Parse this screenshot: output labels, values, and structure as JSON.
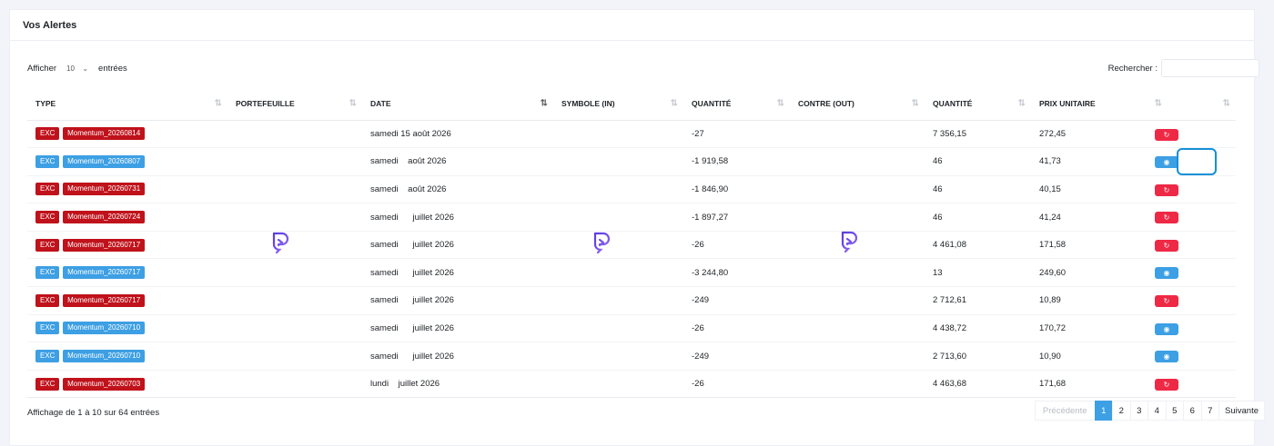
{
  "card": {
    "title": "Vos Alertes"
  },
  "length_control": {
    "prefix": "Afficher",
    "value": "10",
    "suffix": "entrées"
  },
  "search": {
    "label": "Rechercher :",
    "value": ""
  },
  "columns": [
    {
      "label": "TYPE",
      "sort": "⇅"
    },
    {
      "label": "PORTEFEUILLE",
      "sort": "⇅"
    },
    {
      "label": "DATE",
      "sort": "⇅"
    },
    {
      "label": "SYMBOLE (IN)",
      "sort": "⇅"
    },
    {
      "label": "QUANTITÉ",
      "sort": "⇅"
    },
    {
      "label": "CONTRE (OUT)",
      "sort": "⇅"
    },
    {
      "label": "QUANTITÉ",
      "sort": "⇅"
    },
    {
      "label": "PRIX UNITAIRE",
      "sort": "⇅"
    },
    {
      "label": "",
      "sort": "⇅"
    }
  ],
  "rows": [
    {
      "type": "EXC",
      "name": "Momentum_20260814",
      "color": "red",
      "date": "samedi 15 août 2026",
      "qty_in": "-27",
      "qty_out": "7 356,15",
      "price": "272,45",
      "action": "undo"
    },
    {
      "type": "EXC",
      "name": "Momentum_20260807",
      "color": "blue",
      "date": "samedi    août 2026",
      "qty_in": "-1 919,58",
      "qty_out": "46",
      "price": "41,73",
      "action": "view"
    },
    {
      "type": "EXC",
      "name": "Momentum_20260731",
      "color": "red",
      "date": "samedi    août 2026",
      "qty_in": "-1 846,90",
      "qty_out": "46",
      "price": "40,15",
      "action": "undo"
    },
    {
      "type": "EXC",
      "name": "Momentum_20260724",
      "color": "red",
      "date": "samedi      juillet 2026",
      "qty_in": "-1 897,27",
      "qty_out": "46",
      "price": "41,24",
      "action": "undo"
    },
    {
      "type": "EXC",
      "name": "Momentum_20260717",
      "color": "red",
      "date": "samedi      juillet 2026",
      "qty_in": "-26",
      "qty_out": "4 461,08",
      "price": "171,58",
      "action": "undo"
    },
    {
      "type": "EXC",
      "name": "Momentum_20260717",
      "color": "blue",
      "date": "samedi      juillet 2026",
      "qty_in": "-3 244,80",
      "qty_out": "13",
      "price": "249,60",
      "action": "view"
    },
    {
      "type": "EXC",
      "name": "Momentum_20260717",
      "color": "red",
      "date": "samedi      juillet 2026",
      "qty_in": "-249",
      "qty_out": "2 712,61",
      "price": "10,89",
      "action": "undo"
    },
    {
      "type": "EXC",
      "name": "Momentum_20260710",
      "color": "blue",
      "date": "samedi      juillet 2026",
      "qty_in": "-26",
      "qty_out": "4 438,72",
      "price": "170,72",
      "action": "view"
    },
    {
      "type": "EXC",
      "name": "Momentum_20260710",
      "color": "blue",
      "date": "samedi      juillet 2026",
      "qty_in": "-249",
      "qty_out": "2 713,60",
      "price": "10,90",
      "action": "view"
    },
    {
      "type": "EXC",
      "name": "Momentum_20260703",
      "color": "red",
      "date": "lundi    juillet 2026",
      "qty_in": "-26",
      "qty_out": "4 463,68",
      "price": "171,68",
      "action": "undo"
    }
  ],
  "footer": {
    "info": "Affichage de 1 à 10 sur 64 entrées"
  },
  "pagination": {
    "previous": "Précédente",
    "pages": [
      "1",
      "2",
      "3",
      "4",
      "5",
      "6",
      "7"
    ],
    "current": "1",
    "next": "Suivante"
  },
  "icons": {
    "undo": "↻",
    "view": "◉",
    "chevron": "⌄",
    "logo": "portfolio-logo-icon"
  },
  "colors": {
    "red": "#c0121b",
    "blue": "#3d9fe4",
    "undo_button": "#ee2945",
    "logo_from": "#5b3ce0",
    "logo_to": "#8a63f2"
  }
}
